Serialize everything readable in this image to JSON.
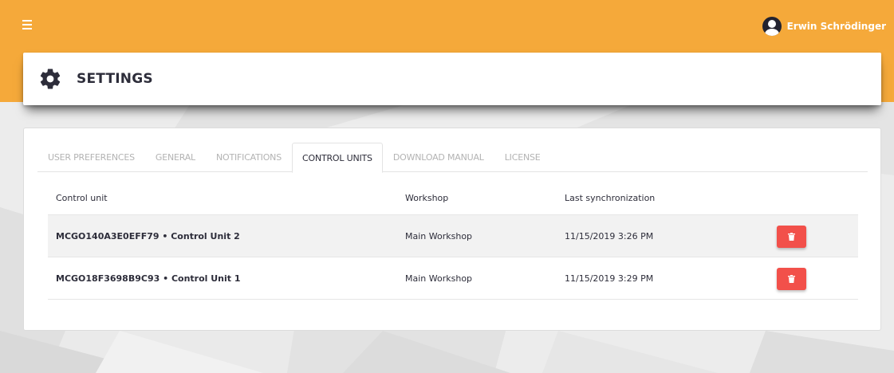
{
  "colors": {
    "accent": "#f5a93a",
    "danger": "#f2504a",
    "text": "#2d2d3a"
  },
  "header": {
    "menu_icon": "hamburger-icon",
    "user_name": "Erwin Schrödinger",
    "user_icon": "user-avatar-icon"
  },
  "settings": {
    "title": "SETTINGS",
    "icon": "gear-icon"
  },
  "tabs": [
    {
      "label": "USER PREFERENCES",
      "active": false
    },
    {
      "label": "GENERAL",
      "active": false
    },
    {
      "label": "NOTIFICATIONS",
      "active": false
    },
    {
      "label": "CONTROL UNITS",
      "active": true
    },
    {
      "label": "DOWNLOAD MANUAL",
      "active": false
    },
    {
      "label": "LICENSE",
      "active": false
    }
  ],
  "table": {
    "columns": [
      "Control unit",
      "Workshop",
      "Last synchronization"
    ],
    "rows": [
      {
        "name": "MCGO140A3E0EFF79 • Control Unit 2",
        "workshop": "Main Workshop",
        "last_sync": "11/15/2019 3:26 PM",
        "action_icon": "trash-icon"
      },
      {
        "name": "MCGO18F3698B9C93 • Control Unit 1",
        "workshop": "Main Workshop",
        "last_sync": "11/15/2019 3:29 PM",
        "action_icon": "trash-icon"
      }
    ]
  }
}
